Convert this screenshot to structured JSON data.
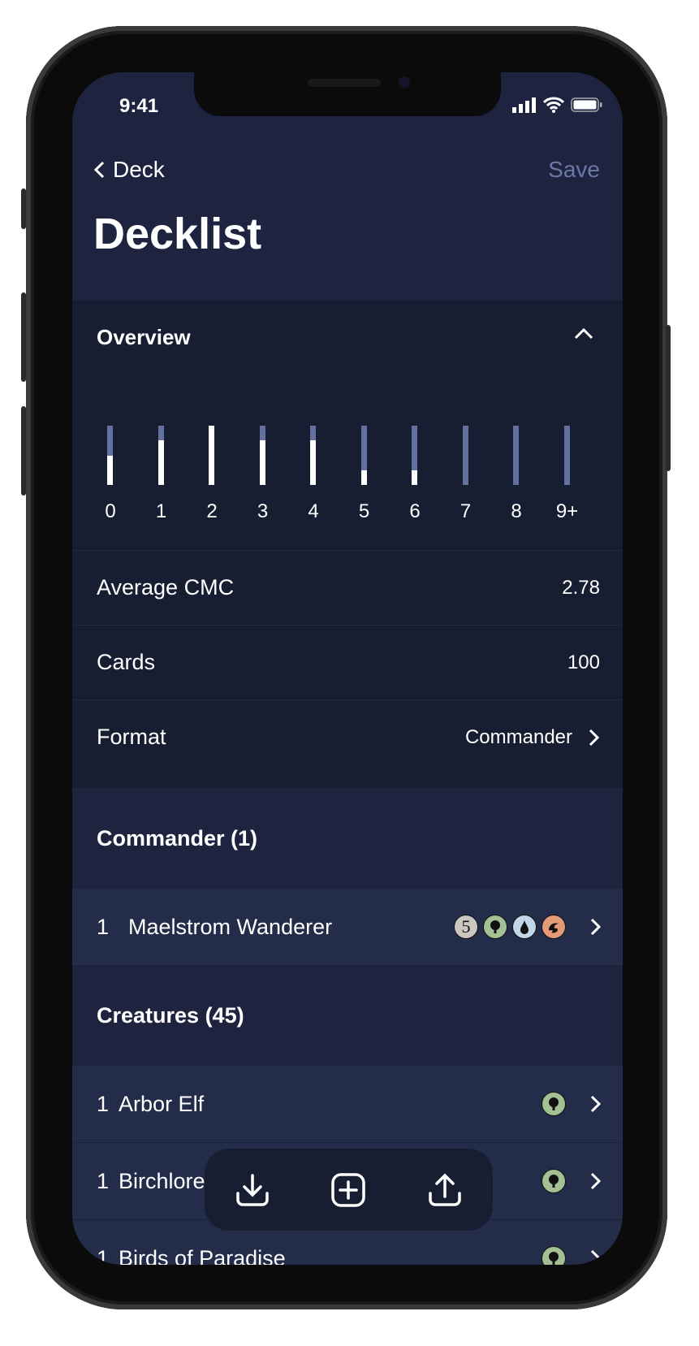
{
  "status_bar": {
    "time": "9:41"
  },
  "nav": {
    "back_label": "Deck",
    "save_label": "Save"
  },
  "page_title": "Decklist",
  "overview": {
    "title": "Overview",
    "chart_data": {
      "type": "bar",
      "categories": [
        "0",
        "1",
        "2",
        "3",
        "4",
        "5",
        "6",
        "7",
        "8",
        "9+"
      ],
      "values": [
        0.5,
        0.75,
        1.0,
        0.75,
        0.75,
        0.25,
        0.25,
        0,
        0,
        0
      ],
      "colors": {
        "fill": "#ffffff",
        "track": "#63719f"
      }
    },
    "stats": [
      {
        "label": "Average CMC",
        "value": "2.78"
      },
      {
        "label": "Cards",
        "value": "100"
      },
      {
        "label": "Format",
        "value": "Commander"
      }
    ]
  },
  "sections": [
    {
      "title": "Commander (1)",
      "cards": [
        {
          "qty": "1",
          "name": "Maelstrom Wanderer",
          "mana": [
            "5",
            "G",
            "U",
            "R"
          ]
        }
      ]
    },
    {
      "title": "Creatures (45)",
      "cards": [
        {
          "qty": "1",
          "name": "Arbor Elf",
          "mana": [
            "G"
          ]
        },
        {
          "qty": "1",
          "name": "Birchlore Rangers",
          "mana": [
            "G"
          ]
        },
        {
          "qty": "1",
          "name": "Birds of Paradise",
          "mana": [
            "G"
          ]
        }
      ]
    }
  ],
  "toolbar": {
    "icons": [
      "download-icon",
      "add-icon",
      "share-icon"
    ]
  },
  "colors": {
    "header_bg": "#1e2440",
    "overview_bg": "#181e31",
    "row_bg": "#232c48",
    "accent": "#6b77a6"
  }
}
